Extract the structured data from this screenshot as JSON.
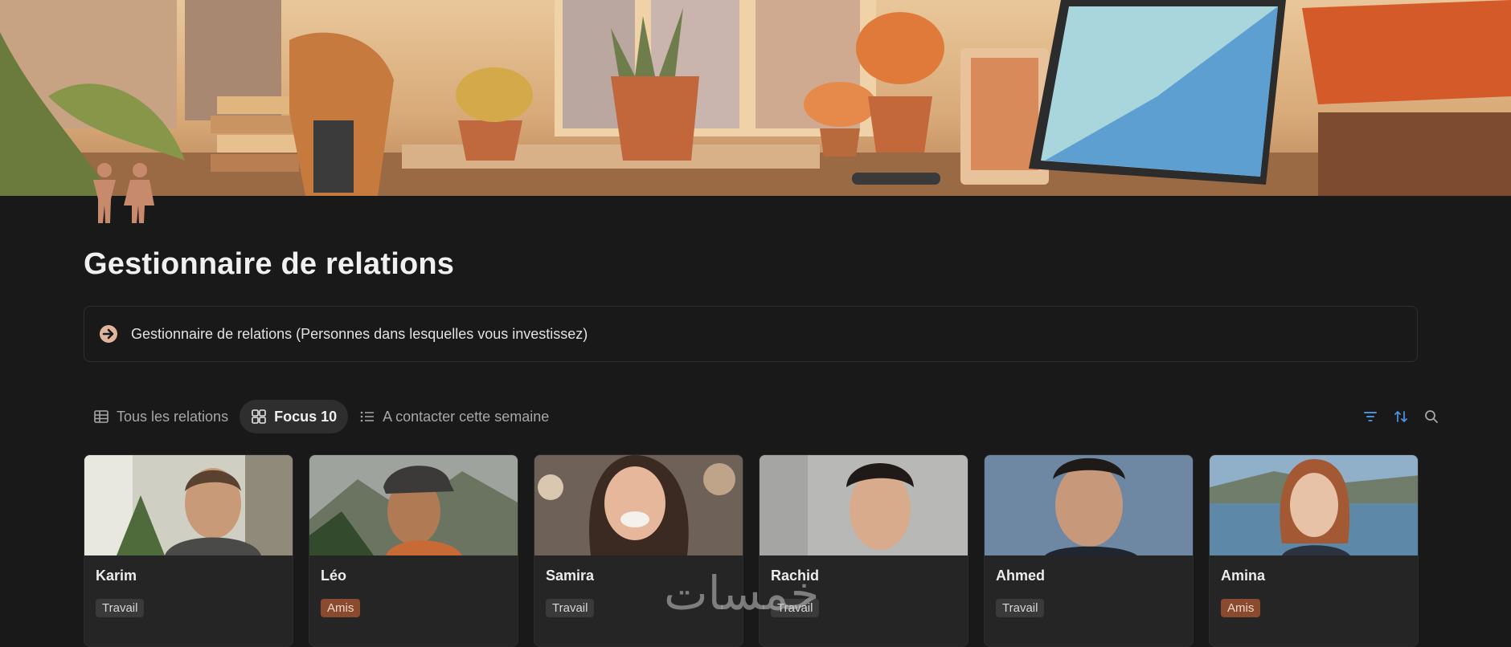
{
  "page": {
    "title": "Gestionnaire de relations",
    "icon": "people-icon",
    "callout": {
      "icon": "arrow-right-circle-icon",
      "text": "Gestionnaire de relations (Personnes dans lesquelles vous investissez)"
    }
  },
  "tabs": [
    {
      "label": "Tous les relations",
      "icon": "table-icon",
      "active": false
    },
    {
      "label": "Focus 10",
      "icon": "gallery-icon",
      "active": true
    },
    {
      "label": "A contacter cette semaine",
      "icon": "list-icon",
      "active": false
    }
  ],
  "toolbar": {
    "filter": "filter-icon",
    "sort": "sort-icon",
    "search": "search-icon"
  },
  "cards": [
    {
      "name": "Karim",
      "tag": "Travail",
      "tag_type": "work"
    },
    {
      "name": "Léo",
      "tag": "Amis",
      "tag_type": "friends"
    },
    {
      "name": "Samira",
      "tag": "Travail",
      "tag_type": "work"
    },
    {
      "name": "Rachid",
      "tag": "Travail",
      "tag_type": "work"
    },
    {
      "name": "Ahmed",
      "tag": "Travail",
      "tag_type": "work"
    },
    {
      "name": "Amina",
      "tag": "Amis",
      "tag_type": "friends"
    }
  ],
  "watermark": "خمسات",
  "colors": {
    "background": "#191919",
    "accent": "#5b9bd5",
    "friends_tag": "#8a4a2e",
    "work_tag": "#3a3a3a"
  }
}
